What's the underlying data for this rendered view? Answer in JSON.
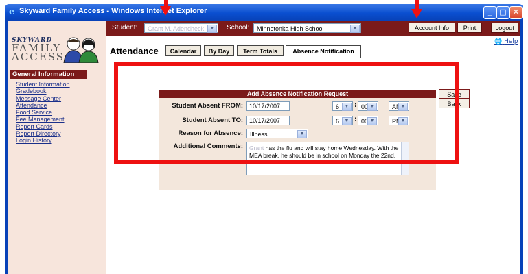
{
  "window": {
    "title": "Skyward Family Access - Windows Internet Explorer",
    "min": "_",
    "max": "□",
    "close": "✕"
  },
  "topbar": {
    "student_label": "Student:",
    "student_value": "Grant M. Adendheck",
    "school_label": "School:",
    "school_value": "Minnetonka High School",
    "buttons": [
      "Account Info",
      "Print",
      "Logout"
    ]
  },
  "logo": {
    "skyward": "SKYWARD",
    "family": "FAMILY",
    "access": "ACCESS"
  },
  "sidebar": {
    "heading": "General Information",
    "links": [
      "Student Information",
      "Gradebook",
      "Message Center",
      "Attendance",
      "Food Service",
      "Fee Management",
      "Report Cards",
      "Report Directory",
      "Login History"
    ]
  },
  "page": {
    "help": "Help",
    "title": "Attendance",
    "tabs": [
      "Calendar",
      "By Day",
      "Term Totals",
      "Absence Notification"
    ],
    "active_tab": "Absence Notification"
  },
  "form": {
    "heading": "Add Absence Notification Request",
    "absent_from_label": "Student Absent FROM:",
    "absent_from_date": "10/17/2007",
    "from_hour": "6",
    "from_minute": "00",
    "from_ampm": "AM",
    "absent_to_label": "Student Absent TO:",
    "absent_to_date": "10/17/2007",
    "to_hour": "6",
    "to_minute": "00",
    "to_ampm": "PM",
    "reason_label": "Reason for Absence:",
    "reason_value": "Illness",
    "comments_label": "Additional Comments:",
    "comments_name": "Grant",
    "comments_text": " has the flu and will stay home Wednesday. With the MEA break, he should be in school on Monday the 22nd.",
    "save": "Save",
    "back": "Back"
  },
  "colors": {
    "accent": "#7b1a1a",
    "sidebar_bg": "#f7e5dc",
    "annotation": "#ee1111",
    "titlebar": "#0a4fd0"
  }
}
